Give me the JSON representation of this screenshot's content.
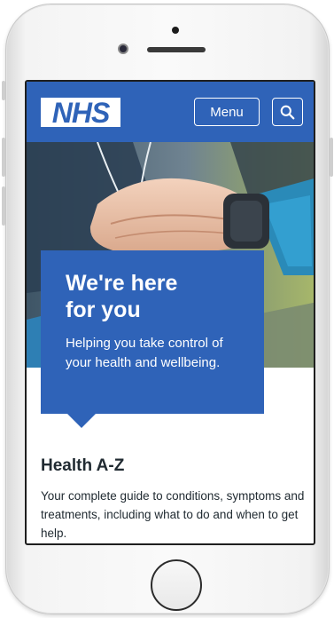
{
  "header": {
    "logo_text": "NHS",
    "menu_label": "Menu",
    "search_icon": "search-icon"
  },
  "promo": {
    "title_line1": "We're here",
    "title_line2": "for you",
    "text": "Helping you take control of your health and wellbeing."
  },
  "health_az": {
    "title": "Health A-Z",
    "description": "Your complete guide to conditions, symptoms and treatments, including what to do and when to get help."
  },
  "colors": {
    "nhs_blue": "#2f63b8",
    "text_dark": "#212b32"
  }
}
